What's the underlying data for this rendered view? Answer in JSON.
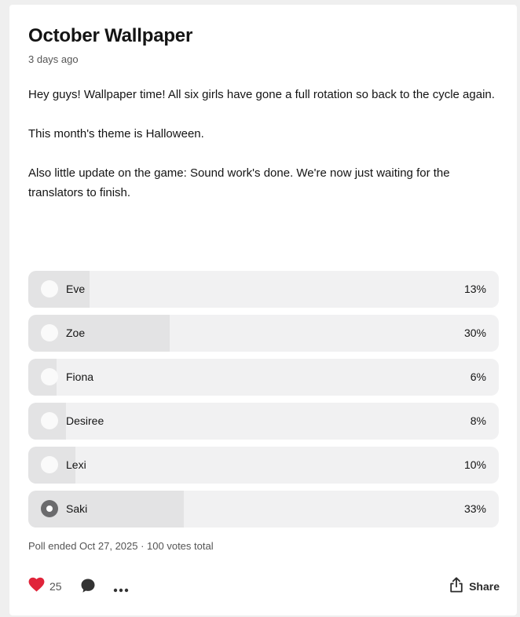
{
  "post": {
    "title": "October Wallpaper",
    "timestamp": "3 days ago",
    "paragraphs": [
      "Hey guys! Wallpaper time! All six girls have gone a full rotation so back to the cycle again.",
      "This month's theme is Halloween.",
      "Also little update on the game: Sound work's done. We're now just waiting for the translators to finish."
    ]
  },
  "poll": {
    "options": [
      {
        "label": "Eve",
        "percent_text": "13%",
        "percent": 13,
        "selected": false
      },
      {
        "label": "Zoe",
        "percent_text": "30%",
        "percent": 30,
        "selected": false
      },
      {
        "label": "Fiona",
        "percent_text": "6%",
        "percent": 6,
        "selected": false
      },
      {
        "label": "Desiree",
        "percent_text": "8%",
        "percent": 8,
        "selected": false
      },
      {
        "label": "Lexi",
        "percent_text": "10%",
        "percent": 10,
        "selected": false
      },
      {
        "label": "Saki",
        "percent_text": "33%",
        "percent": 33,
        "selected": true
      }
    ],
    "footer": "Poll ended Oct 27, 2025 · 100 votes total"
  },
  "actions": {
    "like_count": "25",
    "share_label": "Share",
    "like_icon": "heart-icon",
    "comment_icon": "speech-bubble-icon",
    "more_icon": "ellipsis-icon",
    "share_icon": "share-upload-icon"
  },
  "colors": {
    "heart": "#e0243a",
    "option_bg": "#f1f1f2",
    "option_fill": "#e3e3e4",
    "selected_radio": "#6b6b6d",
    "icon_dark": "#2b2b2b"
  }
}
